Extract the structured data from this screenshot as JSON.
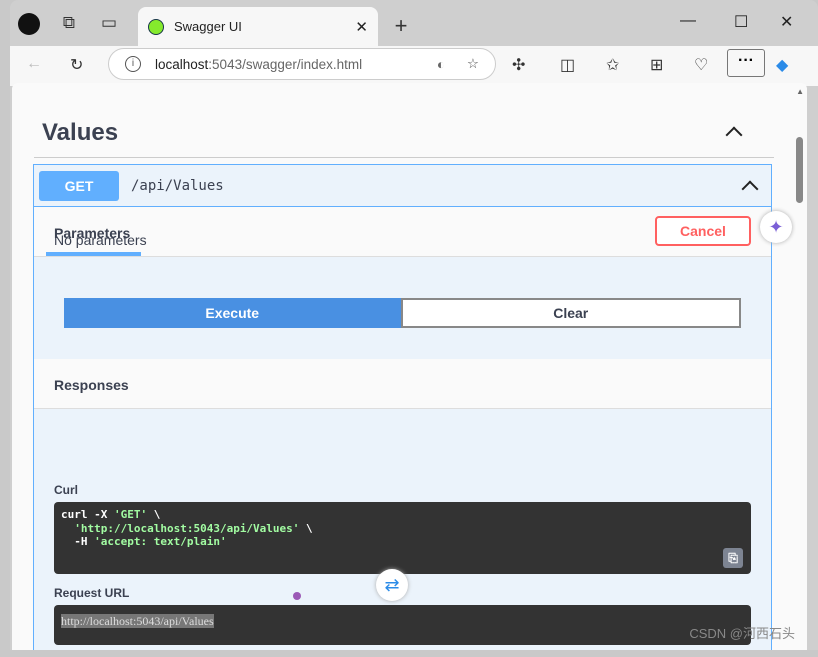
{
  "browser": {
    "tab_title": "Swagger UI",
    "url_host": "localhost",
    "url_rest": ":5043/swagger/index.html"
  },
  "swagger": {
    "section_title": "Values",
    "method": "GET",
    "path": "/api/Values",
    "parameters_tab": "Parameters",
    "cancel": "Cancel",
    "no_parameters": "No parameters",
    "execute": "Execute",
    "clear": "Clear",
    "responses": "Responses",
    "curl_label": "Curl",
    "curl": {
      "l1a": "curl -X ",
      "l1b": "'GET'",
      "l1c": " \\",
      "l2a": "  ",
      "l2b": "'http://localhost:5043/api/Values'",
      "l2c": " \\",
      "l3a": "  -H ",
      "l3b": "'accept: text/plain'"
    },
    "request_url_label": "Request URL",
    "request_url": "http://localhost:5043/api/Values"
  },
  "watermark": "CSDN @河西石头",
  "colors": {
    "get": "#61affe",
    "execute": "#4990e2",
    "cancel": "#ff6060"
  }
}
